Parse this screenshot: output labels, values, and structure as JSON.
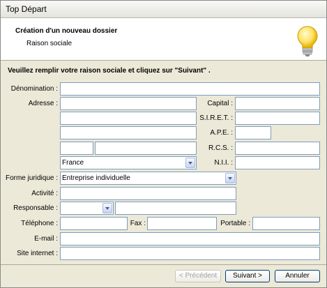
{
  "window": {
    "title": "Top Départ"
  },
  "header": {
    "title": "Création d'un nouveau dossier",
    "subtitle": "Raison sociale",
    "icon": "lightbulb-icon"
  },
  "instruction": "Veuillez remplir votre raison sociale et cliquez sur \"Suivant\" .",
  "labels": {
    "denomination": "Dénomination :",
    "adresse": "Adresse :",
    "capital": "Capital :",
    "siret": "S.I.R.E.T. :",
    "ape": "A.P.E. :",
    "rcs": "R.C.S. :",
    "nii": "N.I.I. :",
    "forme": "Forme juridique :",
    "activite": "Activité :",
    "responsable": "Responsable :",
    "telephone": "Téléphone :",
    "fax": "Fax :",
    "portable": "Portable :",
    "email": "E-mail :",
    "site": "Site internet :"
  },
  "values": {
    "pays": "France",
    "forme_juridique": "Entreprise individuelle"
  },
  "buttons": {
    "precedent": "< Précédent",
    "suivant": "Suivant >",
    "annuler": "Annuler"
  }
}
